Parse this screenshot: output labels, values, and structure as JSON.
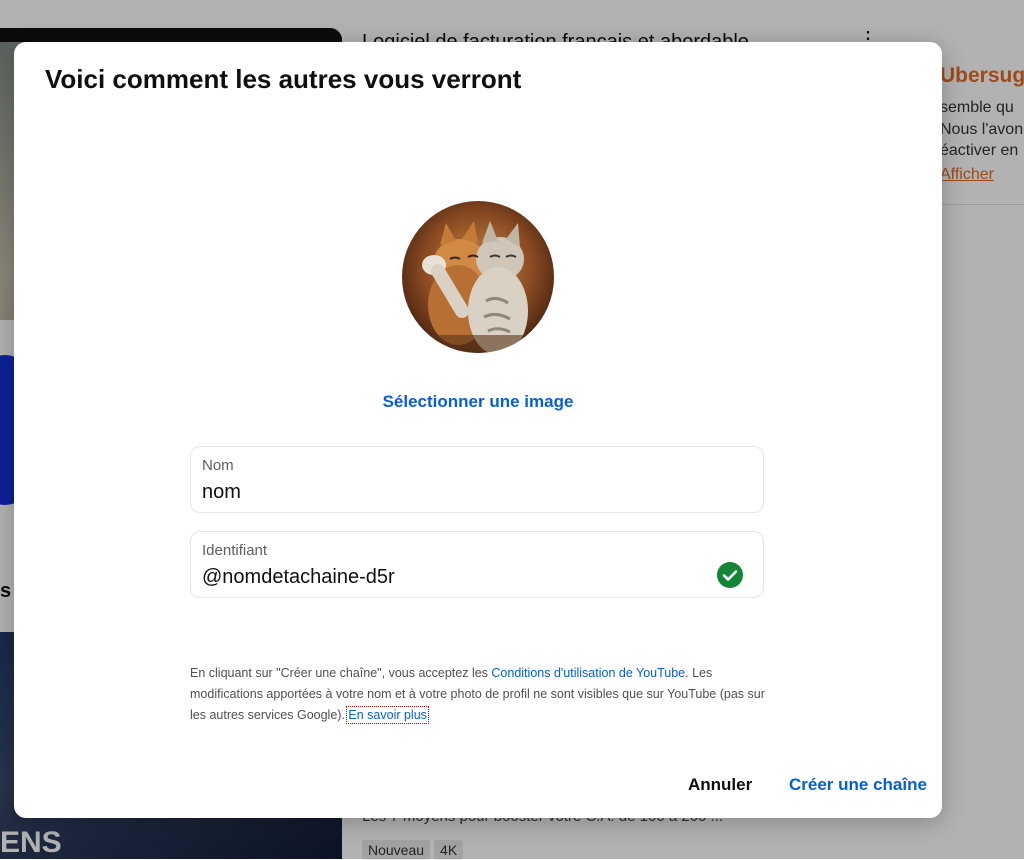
{
  "background": {
    "video_title": "Logiciel de facturation français et abordable",
    "ad_title": "Ubersug",
    "ad_lines": [
      "semble qu",
      "Nous l'avon",
      "éactiver en"
    ],
    "ad_link": "Afficher",
    "section_letter": "s",
    "thumb_text": "ENS",
    "video_subtitle": "Les 7 moyens pour booster votre C.A. de 100 à 200 ...",
    "badges": [
      "Nouveau",
      "4K"
    ]
  },
  "dialog": {
    "title": "Voici comment les autres vous verront",
    "select_image_label": "Sélectionner une image",
    "name_field": {
      "label": "Nom",
      "value": "nom"
    },
    "handle_field": {
      "label": "Identifiant",
      "value": "@nomdetachaine-d5r"
    },
    "legal": {
      "part1": "En cliquant sur \"Créer une chaîne\", vous acceptez les ",
      "terms_link": "Conditions d'utilisation de YouTube",
      "part2": ". Les modifications apportées à votre nom et à votre photo de profil ne sont visibles que sur YouTube (pas sur les autres services Google). ",
      "learn_more_link": "En savoir plus"
    },
    "cancel_label": "Annuler",
    "create_label": "Créer une chaîne"
  },
  "colors": {
    "accent": "#065fd4",
    "success": "#138535",
    "ad_brand": "#e46a25"
  },
  "icons": {
    "handle_status": "check-circle-icon"
  }
}
